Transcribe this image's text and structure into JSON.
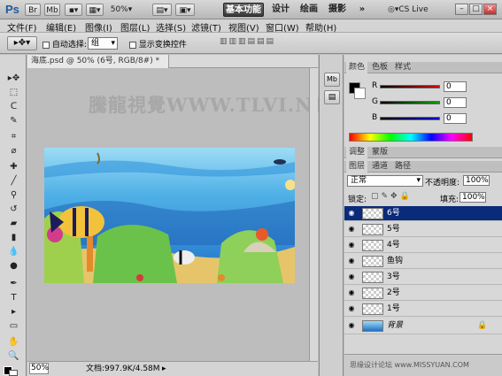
{
  "app": {
    "logo": "Ps"
  },
  "appbar": {
    "zoom": "50%",
    "workspaces": [
      "基本功能",
      "设计",
      "绘画",
      "摄影"
    ],
    "more": "»",
    "cslive": "CS Live",
    "window_buttons": [
      "–",
      "□",
      "×"
    ]
  },
  "menu": [
    "文件(F)",
    "编辑(E)",
    "图像(I)",
    "图层(L)",
    "选择(S)",
    "滤镜(T)",
    "视图(V)",
    "窗口(W)",
    "帮助(H)"
  ],
  "options": {
    "auto_select_label": "自动选择:",
    "auto_select_value": "组",
    "show_transform_label": "显示变换控件"
  },
  "document": {
    "tab_title": "海底.psd @ 50% (6号, RGB/8#) *",
    "close": "×",
    "zoom_status": "50%",
    "doc_size": "文档:997.9K/4.58M"
  },
  "watermark": "騰龍視覺WWW.TLVI.NET",
  "color_panel": {
    "tabs": [
      "颜色",
      "色板",
      "样式"
    ],
    "channels": [
      {
        "label": "R",
        "value": "0",
        "color": "#d00000"
      },
      {
        "label": "G",
        "value": "0",
        "color": "#00a000"
      },
      {
        "label": "B",
        "value": "0",
        "color": "#0000d0"
      }
    ]
  },
  "adjust_panel": {
    "tabs": [
      "调整",
      "蒙版"
    ]
  },
  "layers_panel": {
    "tabs": [
      "图层",
      "通道",
      "路径"
    ],
    "blend_mode": "正常",
    "opacity_label": "不透明度:",
    "opacity": "100%",
    "lock_label": "锁定:",
    "fill_label": "填充:",
    "fill": "100%",
    "layers": [
      {
        "name": "6号",
        "selected": true
      },
      {
        "name": "5号",
        "selected": false
      },
      {
        "name": "4号",
        "selected": false
      },
      {
        "name": "鱼钩",
        "selected": false
      },
      {
        "name": "3号",
        "selected": false
      },
      {
        "name": "2号",
        "selected": false
      },
      {
        "name": "1号",
        "selected": false
      }
    ],
    "background": {
      "name": "背景"
    }
  },
  "site_watermark": "思缘设计论坛 www.MISSYUAN.COM",
  "colors": {
    "selected_layer": "#0a2a7a",
    "ocean_top": "#6ec0ec",
    "ocean_deep": "#1f6fc8",
    "sand": "#e6c56a"
  }
}
